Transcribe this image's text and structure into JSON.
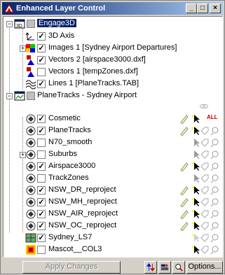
{
  "window": {
    "title": "Enhanced Layer Control",
    "minimize": "_",
    "maximize": "□",
    "close": "×"
  },
  "tree": {
    "engage": {
      "label": "Engage3D",
      "badge": "3D",
      "layers": [
        {
          "label": "3D Axis",
          "checked": true
        },
        {
          "label": "Images 1 [Sydney Airport Departures]",
          "checked": true
        },
        {
          "label": "Vectors 2 [airspace3000.dxf]",
          "checked": true
        },
        {
          "label": "Vectors 1 [tempZones.dxf]",
          "checked": false
        },
        {
          "label": "Lines 1 [PlaneTracks.TAB]",
          "checked": true
        }
      ]
    },
    "planetracks": {
      "label": "PlaneTracks - Sydney Airport",
      "layers": [
        {
          "label": "Cosmetic",
          "checked": true,
          "label_icon": "ALL"
        },
        {
          "label": "PlaneTracks",
          "checked": true
        },
        {
          "label": "N70_smooth",
          "checked": false
        },
        {
          "label": "Suburbs",
          "checked": false
        },
        {
          "label": "Airspace3000",
          "checked": true
        },
        {
          "label": "TrackZones",
          "checked": false
        },
        {
          "label": "NSW_DR_reproject",
          "checked": true
        },
        {
          "label": "NSW_MH_reproject",
          "checked": true
        },
        {
          "label": "NSW_AIR_reproject",
          "checked": true
        },
        {
          "label": "NSW_OC_reproject",
          "checked": true
        },
        {
          "label": "Sydney_LS7",
          "checked": true
        },
        {
          "label": "Mascot__COL3",
          "checked": false
        }
      ]
    }
  },
  "toolbar": {
    "apply": "Apply Changes",
    "options": "Options..."
  },
  "colors": {
    "title_start": "#0a246a",
    "title_end": "#a6caf0",
    "selection": "#0a246a"
  }
}
